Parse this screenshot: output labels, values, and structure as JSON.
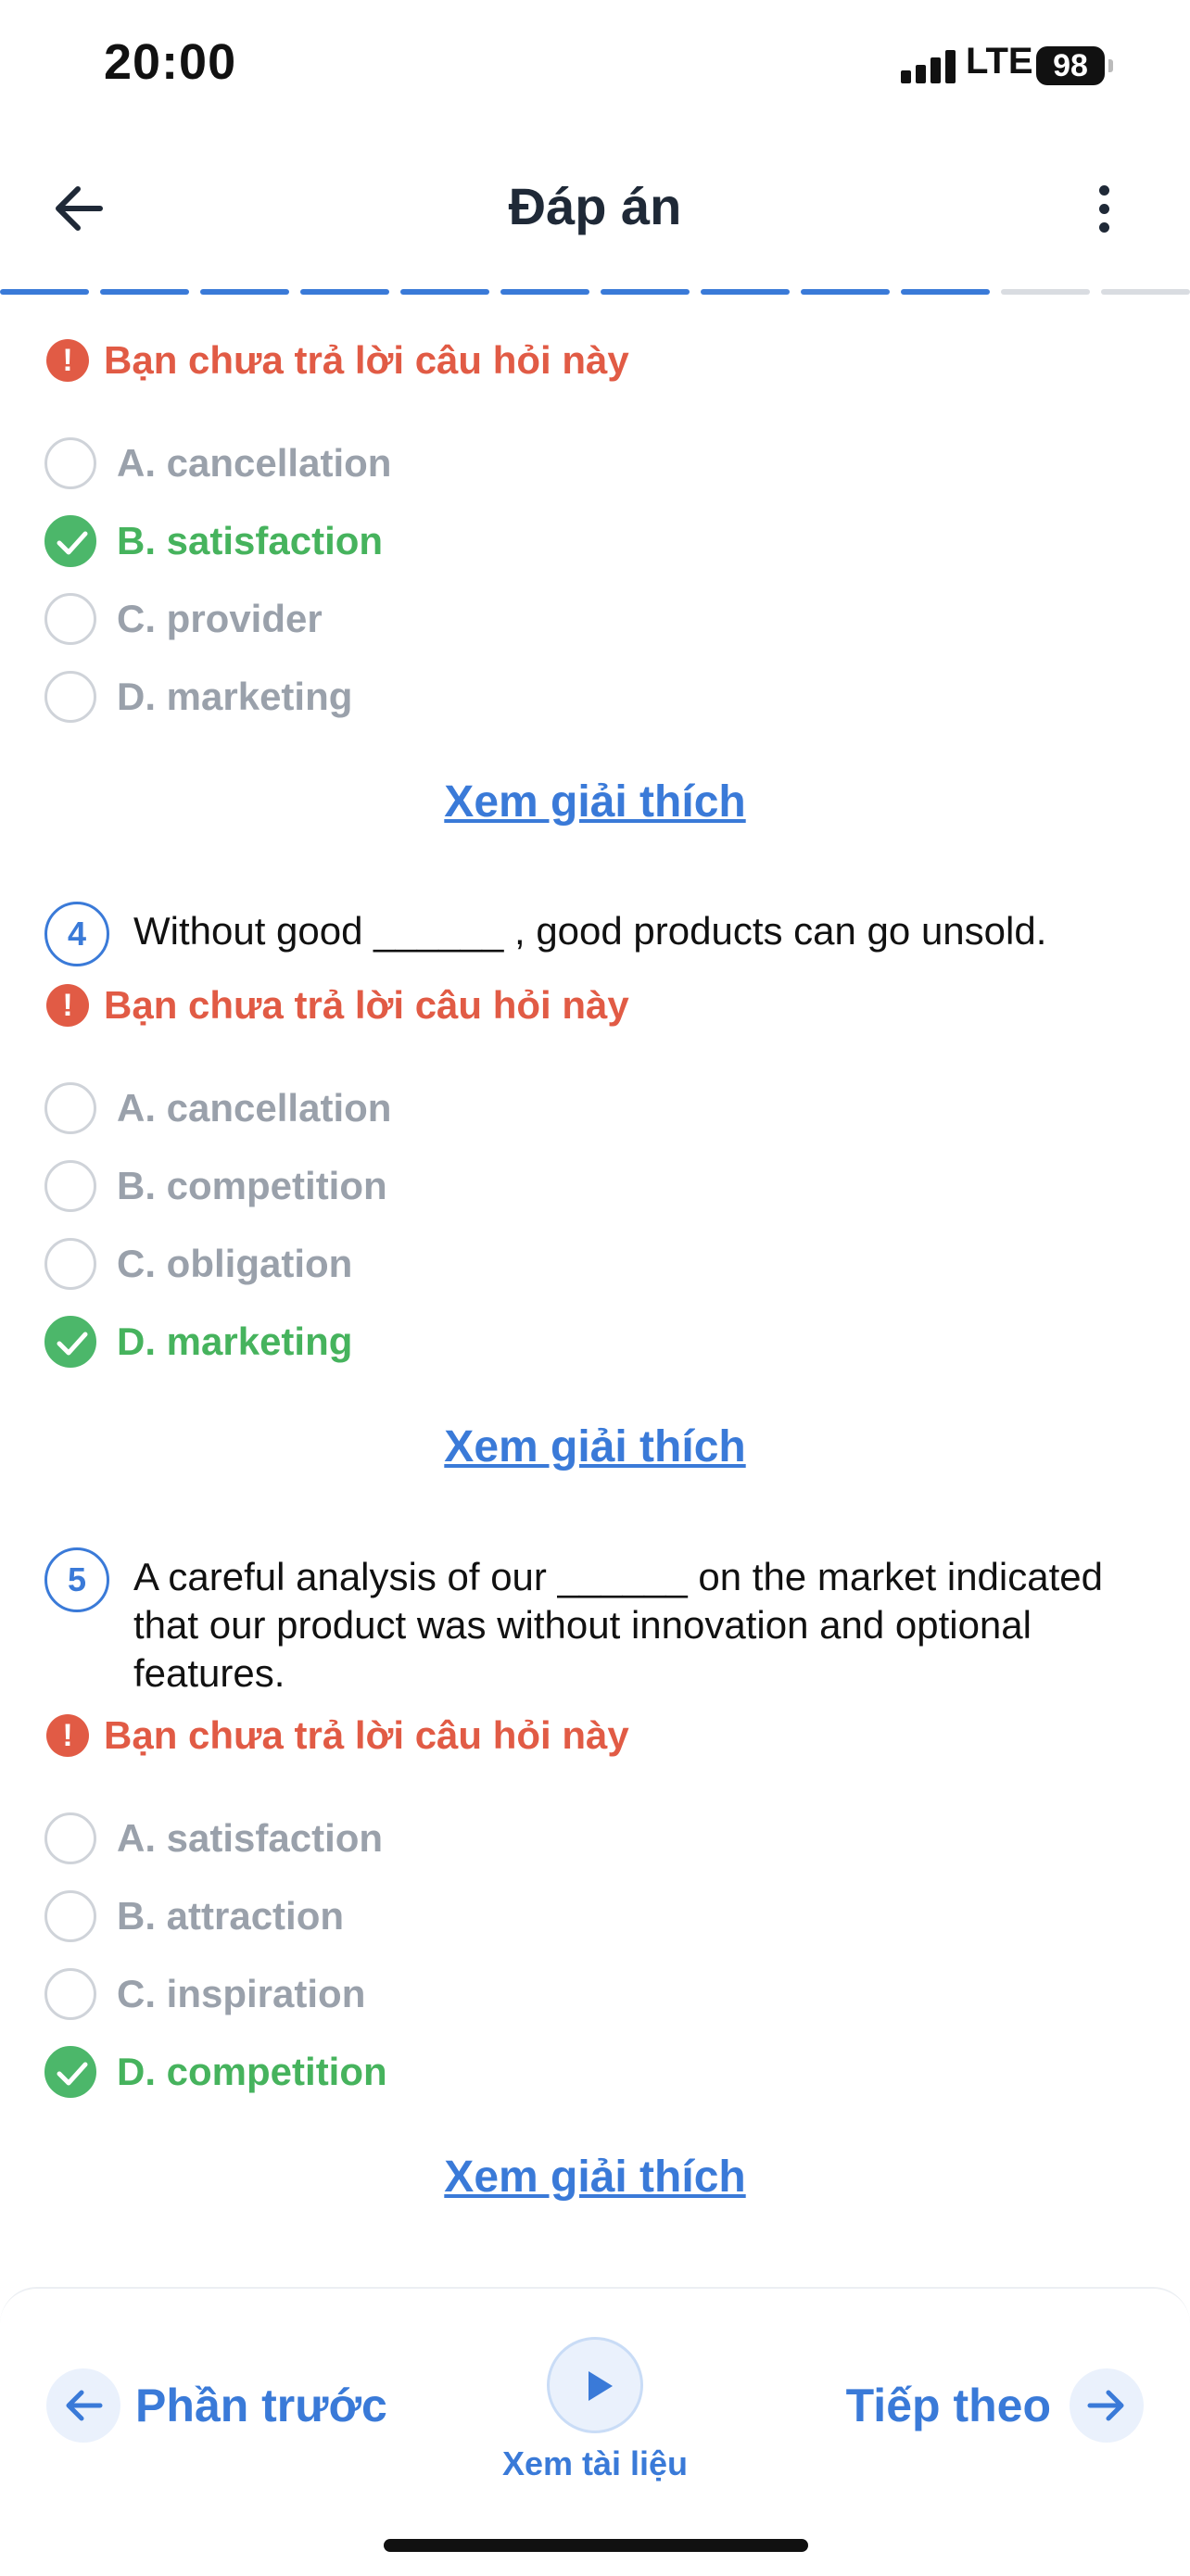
{
  "status_bar": {
    "time": "20:00",
    "network": "LTE",
    "battery": "98"
  },
  "header": {
    "title": "Đáp án"
  },
  "progress": {
    "total_segments": 12,
    "completed_segments": 10,
    "active_color": "#3a7ad8",
    "inactive_color": "#d9dce1"
  },
  "unanswered_text": "Bạn chưa trả lời câu hỏi này",
  "explain_label": "Xem giải thích",
  "questions": [
    {
      "number": "",
      "text": "",
      "options": [
        {
          "label": "A. cancellation",
          "correct": false
        },
        {
          "label": "B. satisfaction",
          "correct": true
        },
        {
          "label": "C. provider",
          "correct": false
        },
        {
          "label": "D. marketing",
          "correct": false
        }
      ]
    },
    {
      "number": "4",
      "text": "Without good ______ , good products can go unsold.",
      "options": [
        {
          "label": "A. cancellation",
          "correct": false
        },
        {
          "label": "B. competition",
          "correct": false
        },
        {
          "label": "C. obligation",
          "correct": false
        },
        {
          "label": "D. marketing",
          "correct": true
        }
      ]
    },
    {
      "number": "5",
      "text": "A careful analysis of our ______ on the market indicated that our product was without innovation and optional features.",
      "options": [
        {
          "label": "A. satisfaction",
          "correct": false
        },
        {
          "label": "B. attraction",
          "correct": false
        },
        {
          "label": "C. inspiration",
          "correct": false
        },
        {
          "label": "D. competition",
          "correct": true
        }
      ]
    }
  ],
  "bottom_nav": {
    "prev_label": "Phần trước",
    "next_label": "Tiếp theo",
    "doc_label": "Xem tài liệu"
  },
  "colors": {
    "accent": "#3a7ad8",
    "error": "#e15b45",
    "correct": "#46b35d",
    "muted": "#9aa1ab"
  }
}
